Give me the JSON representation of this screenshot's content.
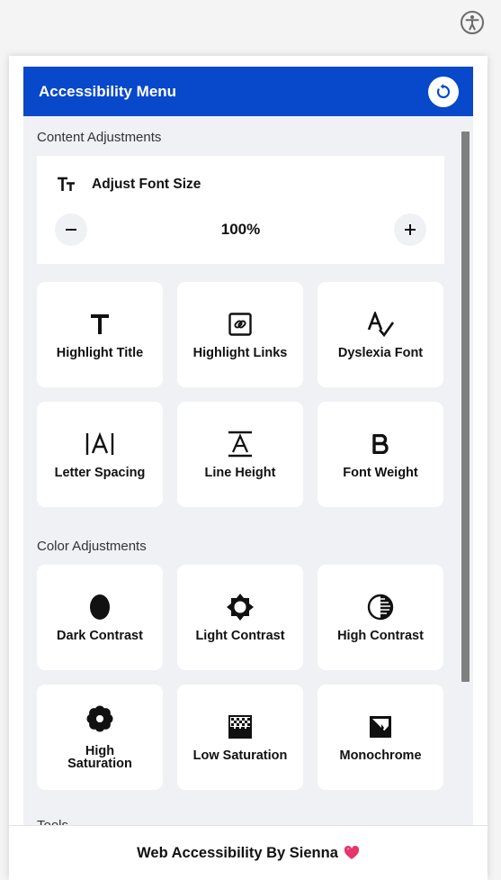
{
  "header": {
    "title": "Accessibility Menu"
  },
  "content_section": {
    "title": "Content Adjustments"
  },
  "font_size": {
    "label": "Adjust Font Size",
    "value": "100%"
  },
  "content_tiles": [
    {
      "label": "Highlight Title",
      "icon": "title-icon"
    },
    {
      "label": "Highlight Links",
      "icon": "link-icon"
    },
    {
      "label": "Dyslexia Font",
      "icon": "dyslexia-font-icon"
    },
    {
      "label": "Letter Spacing",
      "icon": "letter-spacing-icon"
    },
    {
      "label": "Line Height",
      "icon": "line-height-icon"
    },
    {
      "label": "Font Weight",
      "icon": "bold-icon"
    }
  ],
  "color_section": {
    "title": "Color Adjustments"
  },
  "color_tiles": [
    {
      "label": "Dark Contrast",
      "icon": "dark-contrast-icon"
    },
    {
      "label": "Light Contrast",
      "icon": "light-contrast-icon"
    },
    {
      "label": "High Contrast",
      "icon": "high-contrast-icon"
    },
    {
      "label": "High\nSaturation",
      "icon": "high-saturation-icon"
    },
    {
      "label": "Low Saturation",
      "icon": "low-saturation-icon"
    },
    {
      "label": "Monochrome",
      "icon": "monochrome-icon"
    }
  ],
  "tools_section": {
    "title": "Tools"
  },
  "footer": {
    "text": "Web Accessibility By Sienna"
  },
  "colors": {
    "brand": "#0848ca",
    "panel_bg": "#eff1f5",
    "heart": "#e8336d"
  }
}
